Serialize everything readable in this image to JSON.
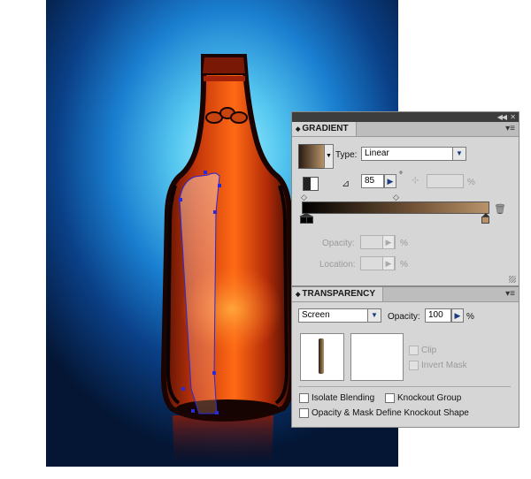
{
  "gradient_panel": {
    "title": "GRADIENT",
    "type_label": "Type:",
    "type_value": "Linear",
    "angle_value": "85",
    "angle_unit": "°",
    "aspect_unit": "%",
    "opacity_label": "Opacity:",
    "opacity_unit": "%",
    "location_label": "Location:",
    "location_unit": "%",
    "gradient_start_color": "#000000",
    "gradient_end_color": "#b8936a"
  },
  "transparency_panel": {
    "title": "TRANSPARENCY",
    "blend_mode": "Screen",
    "opacity_label": "Opacity:",
    "opacity_value": "100",
    "opacity_unit": "%",
    "clip_label": "Clip",
    "invert_mask_label": "Invert Mask",
    "isolate_blending_label": "Isolate Blending",
    "knockout_group_label": "Knockout Group",
    "opacity_mask_label": "Opacity & Mask Define Knockout Shape"
  },
  "colors": {
    "panel_bg": "#d6d6d6",
    "panel_header": "#3d3d3d",
    "selection_blue": "#2a2ad8",
    "bottle_orange": "#e8540e"
  }
}
